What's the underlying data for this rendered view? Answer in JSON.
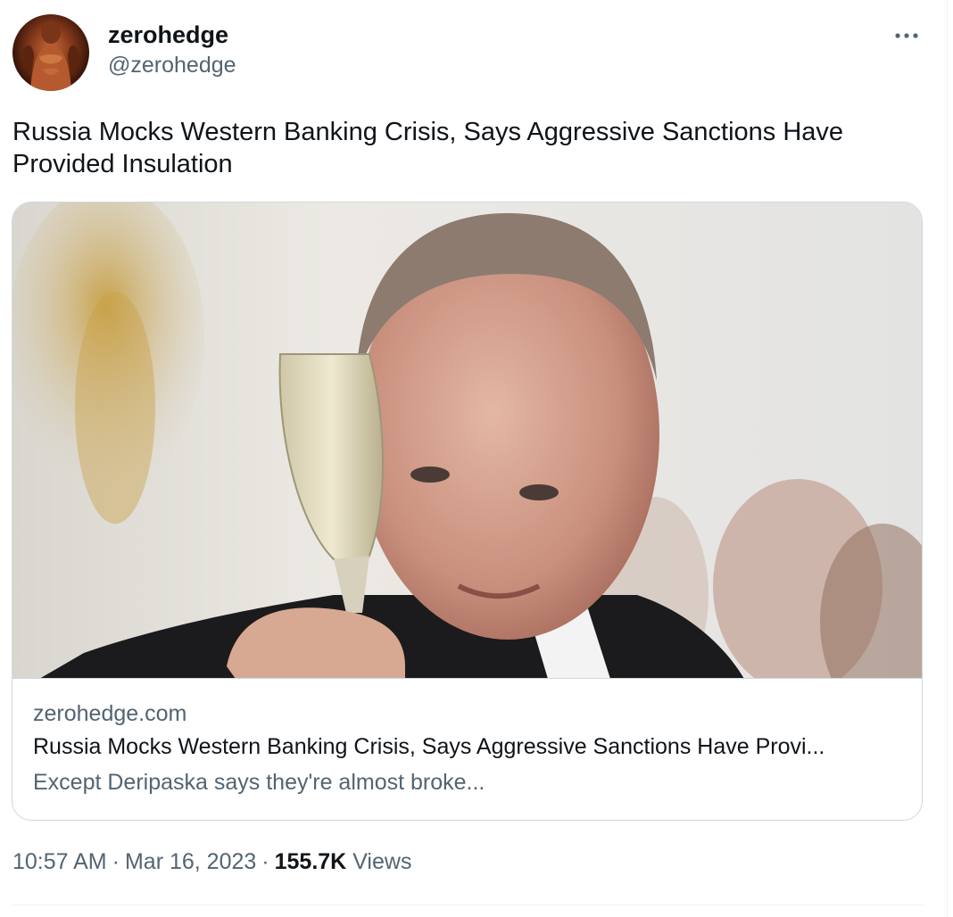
{
  "author": {
    "name": "zerohedge",
    "handle": "@zerohedge",
    "avatar_icon": "avatar-photo"
  },
  "more_icon": "more-horizontal-icon",
  "tweet": {
    "text": "Russia Mocks Western Banking Crisis, Says Aggressive Sanctions Have Provided Insulation"
  },
  "card": {
    "image": "photo-man-raising-champagne-glass",
    "domain": "zerohedge.com",
    "title": "Russia Mocks Western Banking Crisis, Says Aggressive Sanctions Have Provi...",
    "description": "Except Deripaska says they're almost broke..."
  },
  "meta": {
    "time": "10:57 AM",
    "separator": "·",
    "date": "Mar 16, 2023",
    "views_count": "155.7K",
    "views_label": "Views"
  },
  "colors": {
    "text_primary": "#0f1419",
    "text_secondary": "#536471",
    "border": "#cfd9de"
  }
}
